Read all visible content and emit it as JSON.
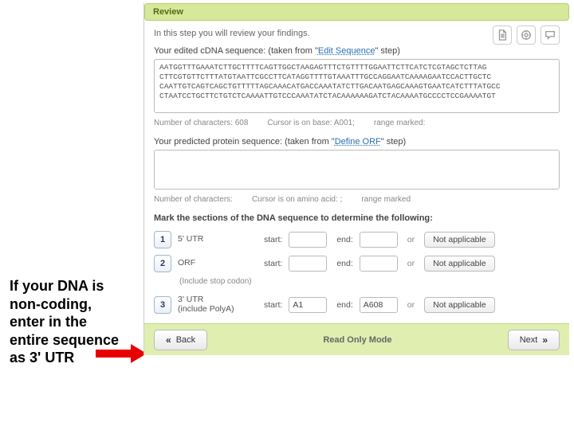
{
  "annotation": "If your DNA is non-coding, enter in the entire sequence as 3' UTR",
  "header": {
    "title": "Review"
  },
  "intro": "In this step you will review your findings.",
  "cdna": {
    "label_prefix": "Your edited cDNA sequence: (taken from \"",
    "link": "Edit Sequence",
    "label_suffix": "\" step)",
    "sequence": "AATGGTTTGAAATCTTGCTTTTCAGTTGGCTAAGAGTTTCTGTTTTGGAATTCTTCATCTCGTAGCTCTTAG\nCTTCGTGTTCTTTATGTAATTCGCCTTCATAGGTTTTGTAAATTTGCCAGGAATCAAAAGAATCCACTTGCTC\nCAATTGTCAGTCAGCTGTTTTTAGCAAACATGACCAAATATCTTGACAATGAGCAAAGTGAATCATCTTTATGCC\nCTAATCCTGCTTCTGTCTCAAAATTGTCCCAAATATCTACAAAAAAGATCTACAAAATGCCCCTCCGAAAATGT",
    "meta_chars": "Number of characters: 608",
    "meta_cursor": "Cursor is on base: A001;",
    "meta_range": "range marked:"
  },
  "protein": {
    "label_prefix": "Your predicted protein sequence: (taken from \"",
    "link": "Define ORF",
    "label_suffix": "\" step)",
    "sequence": "",
    "meta_chars": "Number of characters:",
    "meta_cursor": "Cursor is on amino acid: ;",
    "meta_range": "range marked"
  },
  "mark": {
    "heading": "Mark the sections of the DNA sequence to determine the following:",
    "rows": [
      {
        "num": "1",
        "label": "5' UTR",
        "start": "",
        "end": ""
      },
      {
        "num": "2",
        "label": "ORF",
        "start": "",
        "end": ""
      },
      {
        "num": "3",
        "label": "3' UTR\n(include PolyA)",
        "start": "A1",
        "end": "A608"
      }
    ],
    "note": "(Include stop codon)",
    "start_label": "start:",
    "end_label": "end:",
    "or": "or",
    "na": "Not applicable"
  },
  "footer": {
    "back": "Back",
    "mode": "Read Only Mode",
    "next": "Next"
  }
}
